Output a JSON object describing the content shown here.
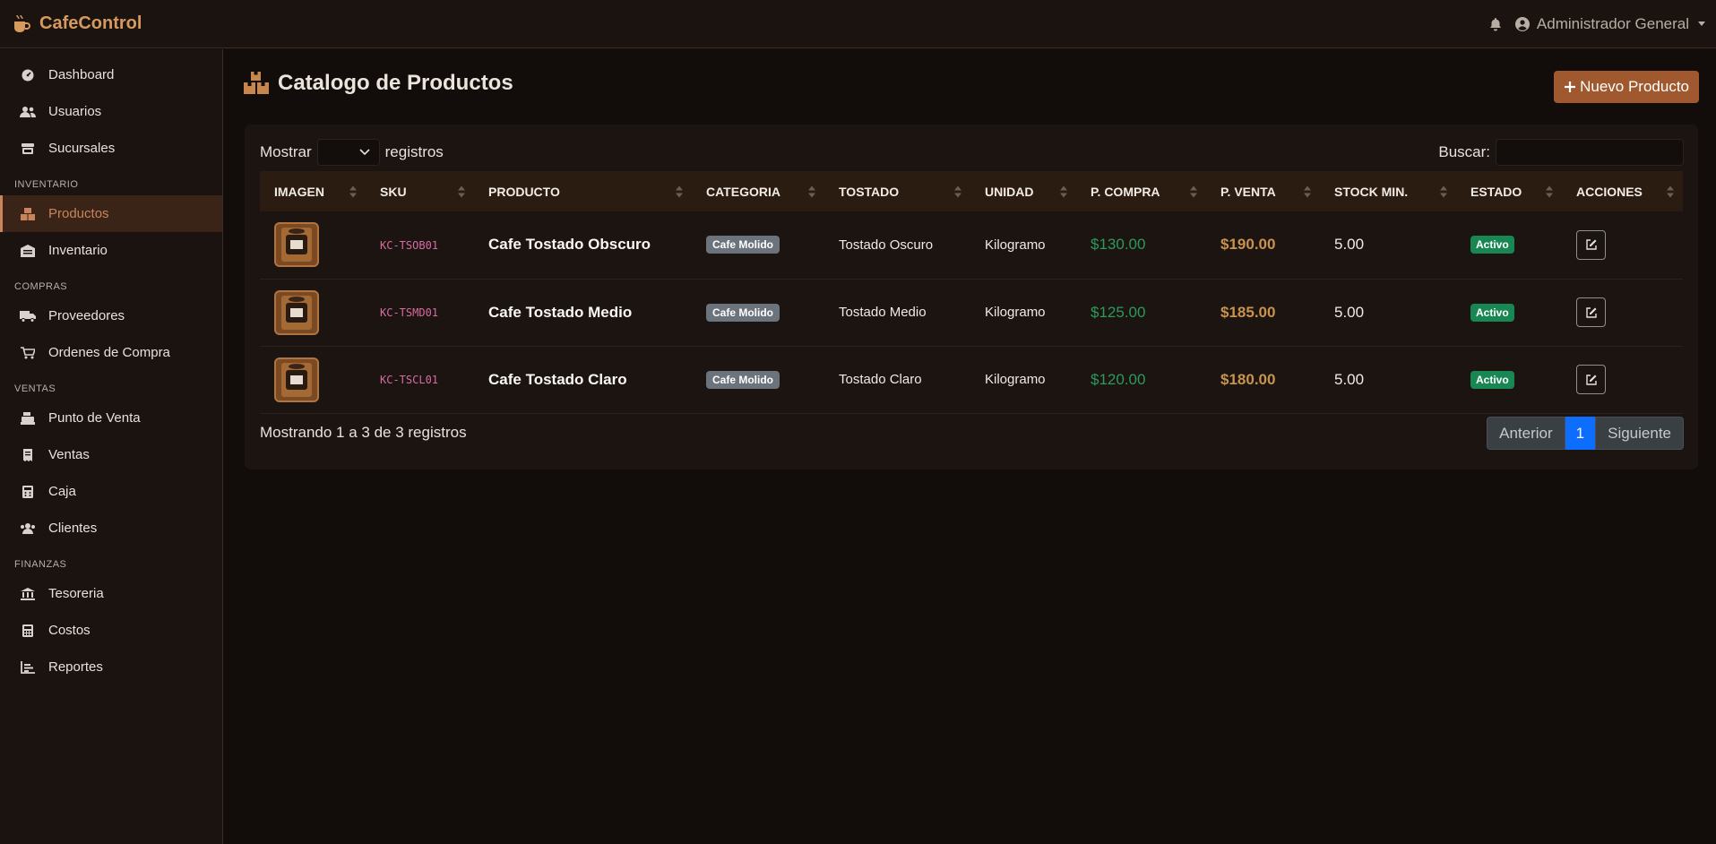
{
  "app": {
    "brand": "CafeControl",
    "brand_color": "#d69a5e"
  },
  "topbar": {
    "bell_icon": "bell-icon",
    "user_name": "Administrador General"
  },
  "sidebar": {
    "items": [
      {
        "label": "Dashboard",
        "icon": "gauge-icon"
      },
      {
        "label": "Usuarios",
        "icon": "users-icon"
      },
      {
        "label": "Sucursales",
        "icon": "store-icon"
      }
    ],
    "sections": [
      {
        "title": "INVENTARIO",
        "items": [
          {
            "label": "Productos",
            "icon": "boxes-icon",
            "active": true
          },
          {
            "label": "Inventario",
            "icon": "warehouse-icon"
          }
        ]
      },
      {
        "title": "COMPRAS",
        "items": [
          {
            "label": "Proveedores",
            "icon": "truck-icon"
          },
          {
            "label": "Ordenes de Compra",
            "icon": "cart-icon"
          }
        ]
      },
      {
        "title": "VENTAS",
        "items": [
          {
            "label": "Punto de Venta",
            "icon": "cash-register-icon"
          },
          {
            "label": "Ventas",
            "icon": "receipt-icon"
          },
          {
            "label": "Caja",
            "icon": "cash-box-icon"
          },
          {
            "label": "Clientes",
            "icon": "clients-icon"
          }
        ]
      },
      {
        "title": "FINANZAS",
        "items": [
          {
            "label": "Tesoreria",
            "icon": "bank-icon"
          },
          {
            "label": "Costos",
            "icon": "calculator-icon"
          },
          {
            "label": "Reportes",
            "icon": "chart-icon"
          }
        ]
      }
    ]
  },
  "page": {
    "title": "Catalogo de Productos",
    "title_icon": "boxes-icon",
    "new_button": "Nuevo Producto",
    "accent_color": "#a0582f"
  },
  "table_controls": {
    "show_label": "Mostrar",
    "show_value": "",
    "records_label": "registros",
    "search_label": "Buscar:",
    "search_value": ""
  },
  "table": {
    "columns": [
      "IMAGEN",
      "SKU",
      "PRODUCTO",
      "CATEGORIA",
      "TOSTADO",
      "UNIDAD",
      "P. COMPRA",
      "P. VENTA",
      "STOCK MIN.",
      "ESTADO",
      "ACCIONES"
    ],
    "rows": [
      {
        "sku": "KC-TSOB01",
        "producto": "Cafe Tostado Obscuro",
        "categoria": "Cafe Molido",
        "tostado": "Tostado Oscuro",
        "unidad": "Kilogramo",
        "p_compra": "$130.00",
        "p_venta": "$190.00",
        "stock_min": "5.00",
        "estado": "Activo"
      },
      {
        "sku": "KC-TSMD01",
        "producto": "Cafe Tostado Medio",
        "categoria": "Cafe Molido",
        "tostado": "Tostado Medio",
        "unidad": "Kilogramo",
        "p_compra": "$125.00",
        "p_venta": "$185.00",
        "stock_min": "5.00",
        "estado": "Activo"
      },
      {
        "sku": "KC-TSCL01",
        "producto": "Cafe Tostado Claro",
        "categoria": "Cafe Molido",
        "tostado": "Tostado Claro",
        "unidad": "Kilogramo",
        "p_compra": "$120.00",
        "p_venta": "$180.00",
        "stock_min": "5.00",
        "estado": "Activo"
      }
    ]
  },
  "footer": {
    "info": "Mostrando 1 a 3 de 3 registros",
    "prev": "Anterior",
    "current_page": "1",
    "next": "Siguiente"
  }
}
